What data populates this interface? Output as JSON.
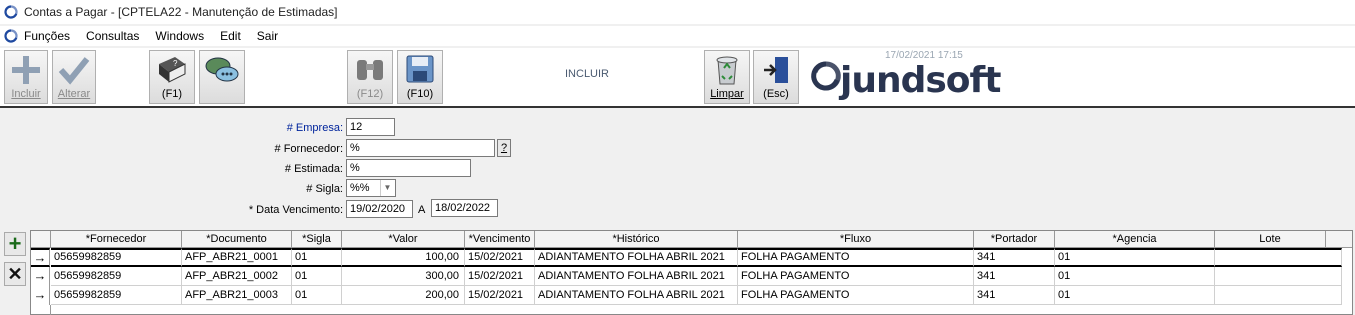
{
  "window": {
    "title": "Contas a Pagar - [CPTELA22 - Manutenção de Estimadas]"
  },
  "menu": [
    "Funções",
    "Consultas",
    "Windows",
    "Edit",
    "Sair"
  ],
  "toolbar": {
    "incluir": "Incluir",
    "alterar": "Alterar",
    "help": "(F1)",
    "search": "(F12)",
    "save": "(F10)",
    "status": "INCLUIR",
    "limpar": "Limpar",
    "esc": "(Esc)",
    "datetime": "17/02/2021 17:15",
    "brand": "jundsoft"
  },
  "form": {
    "empresa_label": "# Empresa:",
    "empresa_value": "12",
    "fornecedor_label": "# Fornecedor:",
    "fornecedor_value": "%",
    "help_btn": "?",
    "estimada_label": "# Estimada:",
    "estimada_value": "%",
    "sigla_label": "# Sigla:",
    "sigla_value": "%%",
    "vencimento_label": "* Data Vencimento:",
    "vencimento_from": "19/02/2020",
    "vencimento_sep": "A",
    "vencimento_to": "18/02/2022"
  },
  "grid": {
    "columns": [
      "*Fornecedor",
      "*Documento",
      "*Sigla",
      "*Valor",
      "*Vencimento",
      "*Histórico",
      "*Fluxo",
      "*Portador",
      "*Agencia",
      "Lote"
    ],
    "rows": [
      [
        "05659982859",
        "AFP_ABR21_0001",
        "01",
        "100,00",
        "15/02/2021",
        "ADIANTAMENTO FOLHA ABRIL 2021",
        "FOLHA PAGAMENTO",
        "341",
        "01",
        ""
      ],
      [
        "05659982859",
        "AFP_ABR21_0002",
        "01",
        "300,00",
        "15/02/2021",
        "ADIANTAMENTO FOLHA ABRIL 2021",
        "FOLHA PAGAMENTO",
        "341",
        "01",
        ""
      ],
      [
        "05659982859",
        "AFP_ABR21_0003",
        "01",
        "200,00",
        "15/02/2021",
        "ADIANTAMENTO FOLHA ABRIL 2021",
        "FOLHA PAGAMENTO",
        "341",
        "01",
        ""
      ]
    ],
    "row_indicator": "→"
  },
  "side": {
    "add": "+",
    "delete": "✕"
  }
}
